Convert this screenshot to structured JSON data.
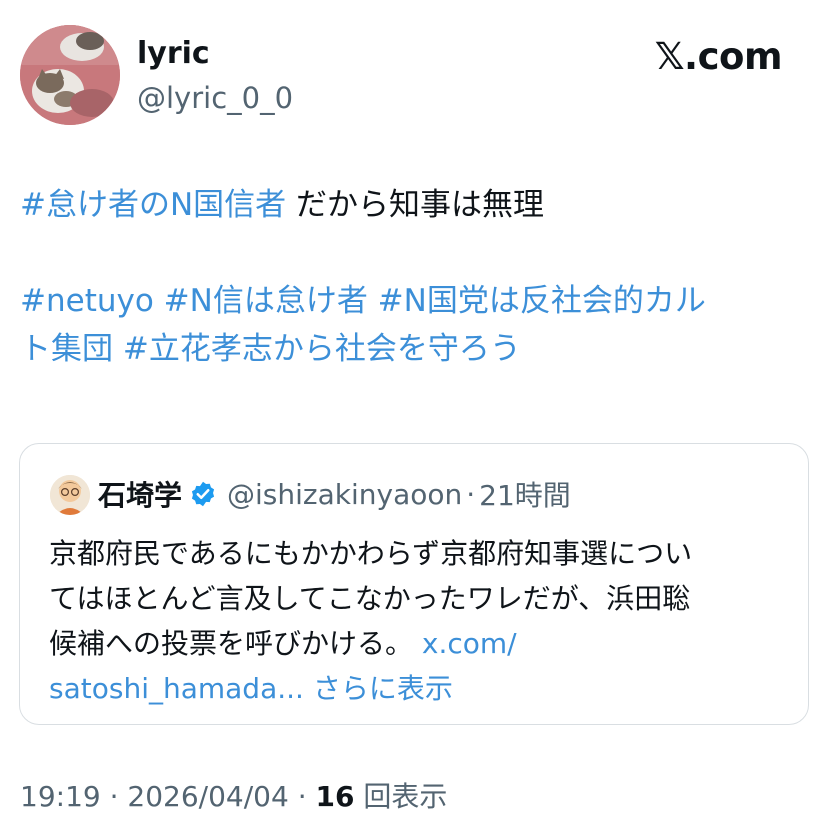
{
  "author": {
    "name": "lyric",
    "handle": "@lyric_0_0",
    "avatar_icon": "cat-avatar"
  },
  "brand": {
    "x_glyph": "𝕏",
    "suffix": ".com"
  },
  "tweet": {
    "line1_tag": "#怠け者のN国信者",
    "line1_text": " だから知事は無理",
    "line3_tags": " #netuyo #N信は怠け者 #N国党は反社会的カル",
    "line4_tags": "ト集団 #立花孝志から社会を守ろう"
  },
  "quote": {
    "name": "石埼学",
    "handle": "@ishizakinyaoon",
    "dot": "·",
    "time": "21時間",
    "body_line1": "京都府民であるにもかかわらず京都府知事選につい",
    "body_line2": "てはほとんど言及してこなかったワレだが、浜田聡",
    "body_line3_text": "候補への投票を呼びかける。 ",
    "body_line3_link": "x.com/",
    "body_line4_link": "satoshi_hamada...",
    "body_line4_more": " さらに表示",
    "verified_icon": "verified-badge-icon",
    "verified_color": "#1d9bf0"
  },
  "meta": {
    "time": "19:19",
    "sep1": " · ",
    "date": "2026/04/04",
    "sep2": " · ",
    "views_count": "16",
    "views_label": " 回表示"
  },
  "colors": {
    "link": "#3c8fd8",
    "text": "#0f1419",
    "secondary": "#536471",
    "border": "#d9dee2"
  }
}
